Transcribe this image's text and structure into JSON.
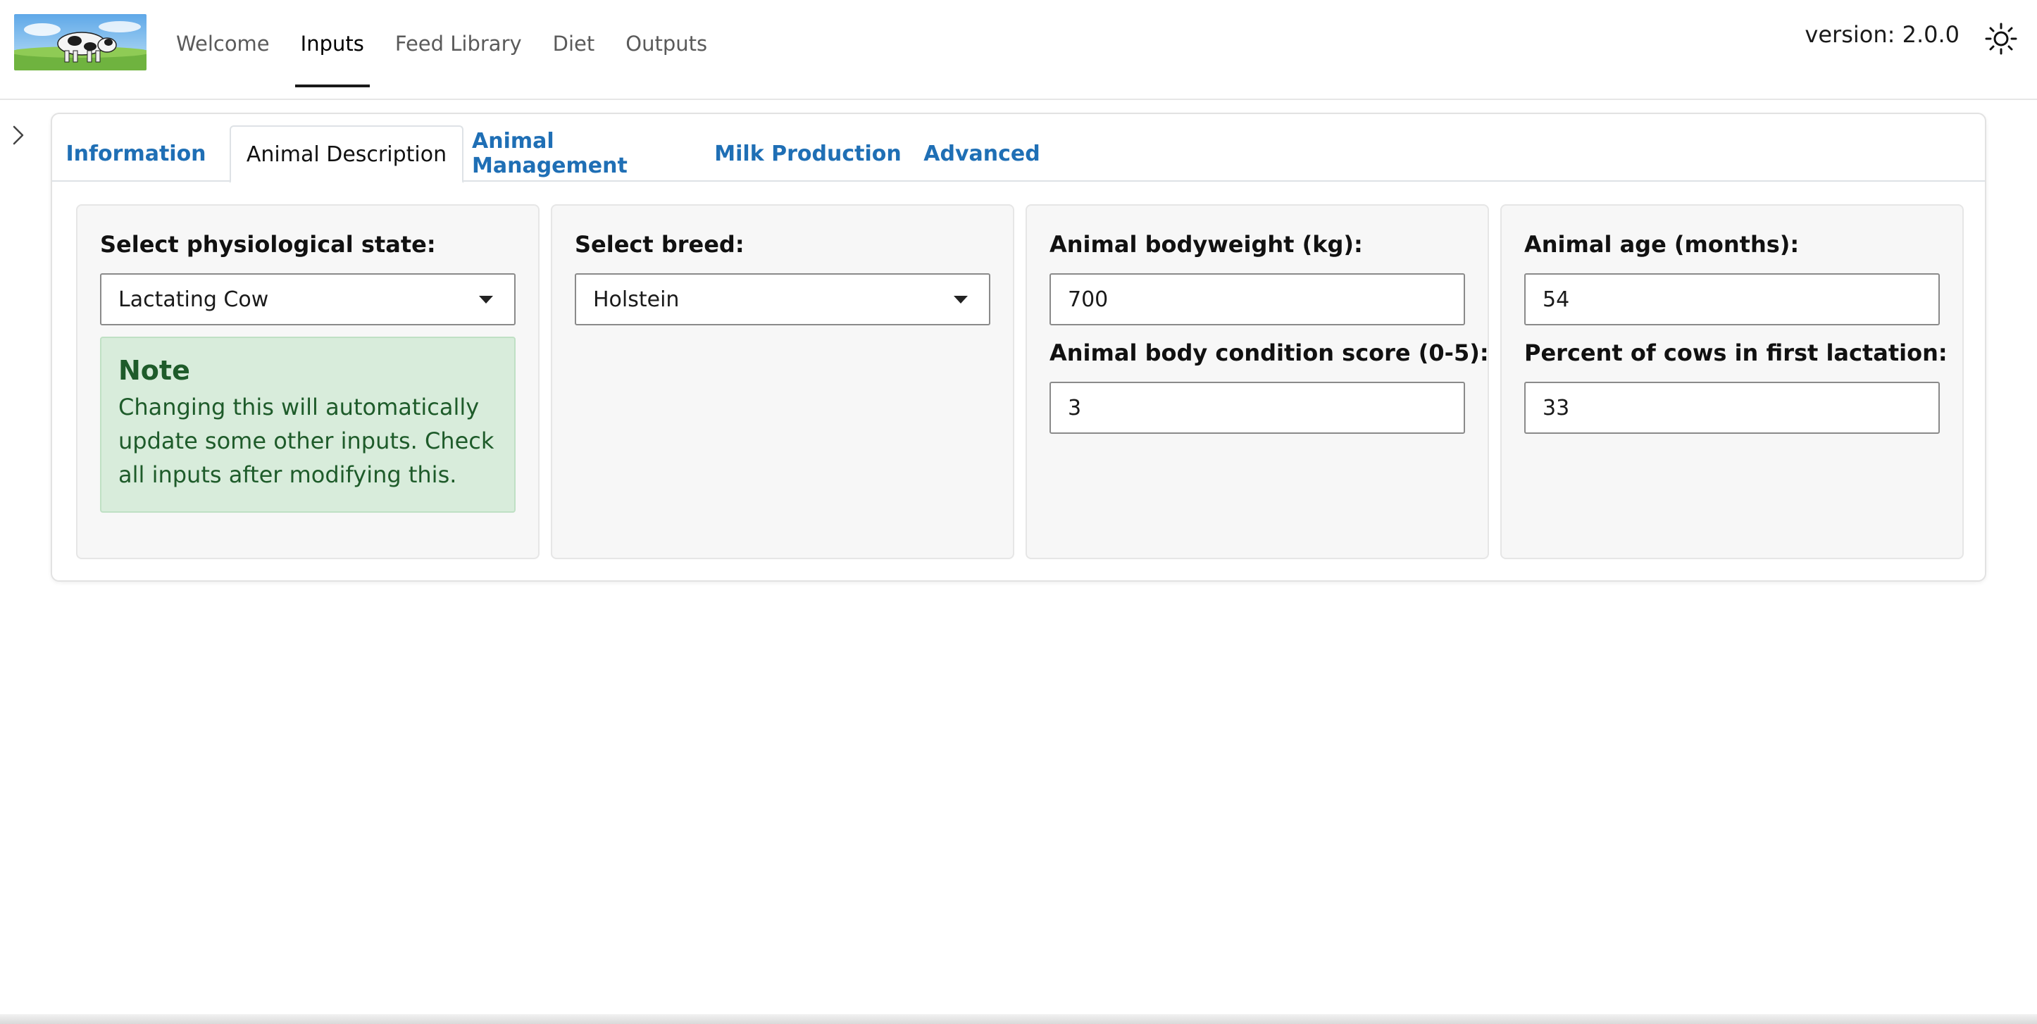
{
  "navbar": {
    "logo_alt": "cow",
    "links": [
      {
        "label": "Welcome"
      },
      {
        "label": "Inputs"
      },
      {
        "label": "Feed Library"
      },
      {
        "label": "Diet"
      },
      {
        "label": "Outputs"
      }
    ],
    "active_link": "Inputs",
    "version_text": "version: 2.0.0",
    "theme_icon": "sun-icon"
  },
  "sidebar": {
    "toggle_icon": "chevron-right-icon"
  },
  "tabs": [
    {
      "label": "Information"
    },
    {
      "label": "Animal Description"
    },
    {
      "label": "Animal Management"
    },
    {
      "label": "Milk Production"
    },
    {
      "label": "Advanced"
    }
  ],
  "active_tab": "Animal Description",
  "panels": {
    "physiological": {
      "label": "Select physiological state:",
      "value": "Lactating Cow",
      "note_title": "Note",
      "note_body": "Changing this will automatically update some other inputs. Check all inputs after modifying this."
    },
    "breed": {
      "label": "Select breed:",
      "value": "Holstein"
    },
    "body": {
      "bodyweight_label": "Animal bodyweight (kg):",
      "bodyweight_value": "700",
      "bcs_label": "Animal body condition score (0-5):",
      "bcs_value": "3"
    },
    "age": {
      "age_label": "Animal age (months):",
      "age_value": "54",
      "first_lactation_label": "Percent of cows in first lactation:",
      "first_lactation_value": "33"
    }
  },
  "colors": {
    "tab_link": "#1f6fb5",
    "note_bg": "#d8ecdb",
    "note_text": "#1e5b2a",
    "panel_bg": "#f7f7f7"
  }
}
